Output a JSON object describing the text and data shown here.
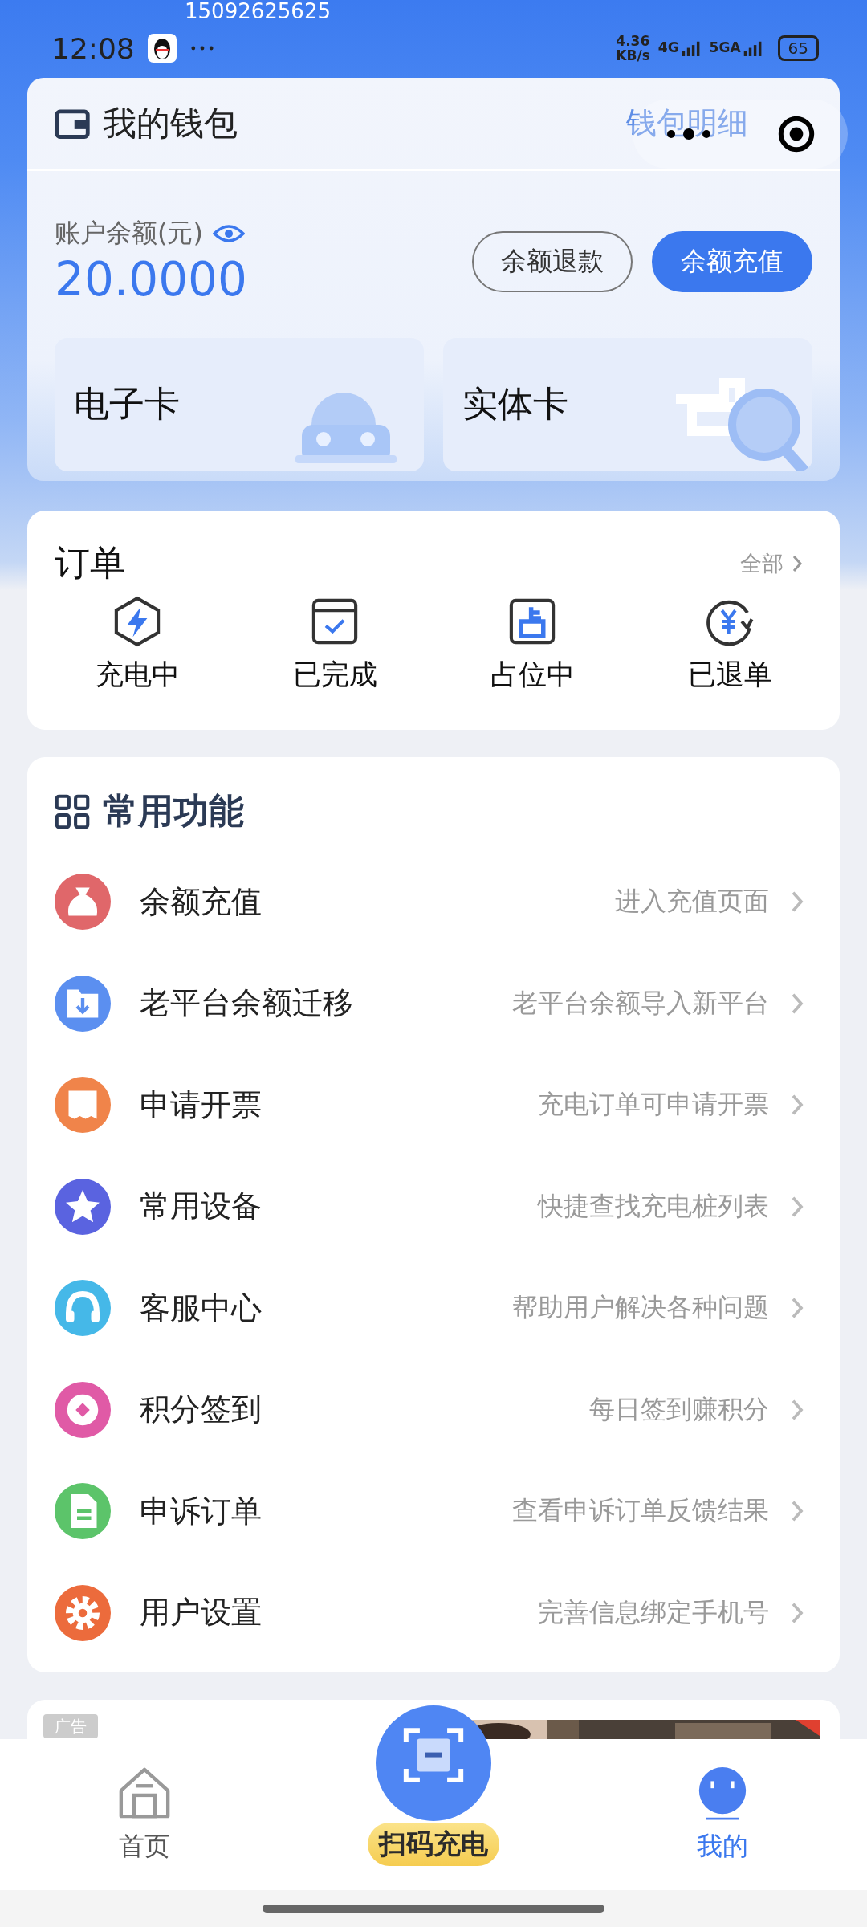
{
  "status_bar": {
    "phone": "15092625625",
    "time": "12:08",
    "speed_value": "4.36",
    "speed_unit": "KB/s",
    "network_1": "4G",
    "network_2": "5GA",
    "battery": "65"
  },
  "wallet": {
    "title": "我的钱包",
    "detail_link": "钱包明细",
    "balance_label": "账户余额(元)",
    "balance": "20.0000",
    "buttons": [
      {
        "label": "余额退款",
        "kind": "outline"
      },
      {
        "label": "余额充值",
        "kind": "primary"
      }
    ],
    "cards": [
      {
        "label": "电子卡"
      },
      {
        "label": "实体卡"
      }
    ]
  },
  "orders": {
    "title": "订单",
    "all_link": "全部",
    "items": [
      {
        "label": "充电中"
      },
      {
        "label": "已完成"
      },
      {
        "label": "占位中"
      },
      {
        "label": "已退单"
      }
    ]
  },
  "functions": {
    "title": "常用功能",
    "items": [
      {
        "label": "余额充值",
        "hint": "进入充值页面",
        "color": "#e0676a"
      },
      {
        "label": "老平台余额迁移",
        "hint": "老平台余额导入新平台",
        "color": "#5b8ff0"
      },
      {
        "label": "申请开票",
        "hint": "充电订单可申请开票",
        "color": "#f0844a"
      },
      {
        "label": "常用设备",
        "hint": "快捷查找充电桩列表",
        "color": "#5a63e0"
      },
      {
        "label": "客服中心",
        "hint": "帮助用户解决各种问题",
        "color": "#45b8e8"
      },
      {
        "label": "积分签到",
        "hint": "每日签到赚积分",
        "color": "#e05aa6"
      },
      {
        "label": "申诉订单",
        "hint": "查看申诉订单反馈结果",
        "color": "#5cc46a"
      },
      {
        "label": "用户设置",
        "hint": "完善信息绑定手机号",
        "color": "#ec6b3c"
      }
    ]
  },
  "ad": {
    "tag": "广告",
    "kind": "picture"
  },
  "nav": {
    "items": [
      {
        "label": "首页",
        "kind": "home",
        "selected": false
      },
      {
        "label": "扫码充电",
        "kind": "scan",
        "selected": false
      },
      {
        "label": "我的",
        "kind": "profile",
        "selected": true
      }
    ]
  }
}
